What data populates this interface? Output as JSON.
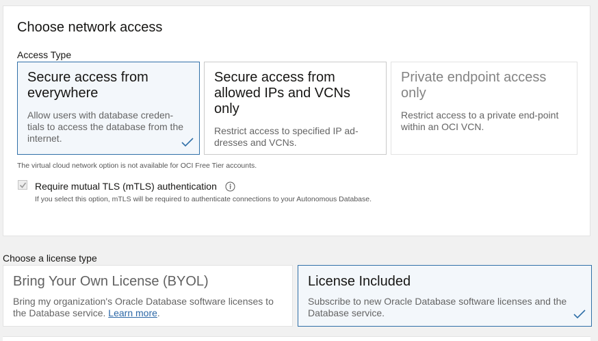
{
  "network_access": {
    "title": "Choose network access",
    "access_type_label": "Access Type",
    "options": [
      {
        "title": "Secure access from everywhere",
        "description": "Allow users with database creden-tials to access the database from the internet.",
        "selected": true,
        "disabled": false
      },
      {
        "title": "Secure access from allowed IPs and VCNs only",
        "description": "Restrict access to specified IP ad-dresses and VCNs.",
        "selected": false,
        "disabled": false
      },
      {
        "title": "Private endpoint access only",
        "description": "Restrict access to a private end-point within an OCI VCN.",
        "selected": false,
        "disabled": true
      }
    ],
    "vcn_note": "The virtual cloud network option is not available for OCI Free Tier accounts.",
    "mtls": {
      "label": "Require mutual TLS (mTLS) authentication",
      "checked": true,
      "disabled": true,
      "help": "If you select this option, mTLS will be required to authenticate connections to your Autonomous Database."
    }
  },
  "license": {
    "label": "Choose a license type",
    "options": [
      {
        "title": "Bring Your Own License (BYOL)",
        "description": "Bring my organization's Oracle Database software licenses to the Database service.",
        "link": "Learn more",
        "trailing": ".",
        "selected": false
      },
      {
        "title": "License Included",
        "description": "Subscribe to new Oracle Database software licenses and the Database service.",
        "selected": true
      }
    ]
  },
  "colors": {
    "accent": "#2f6fa7",
    "selected_bg": "#f3f7fb",
    "link": "#2b67a6"
  },
  "icons": [
    "checkmark-icon",
    "info-icon",
    "checkbox-check-icon"
  ]
}
